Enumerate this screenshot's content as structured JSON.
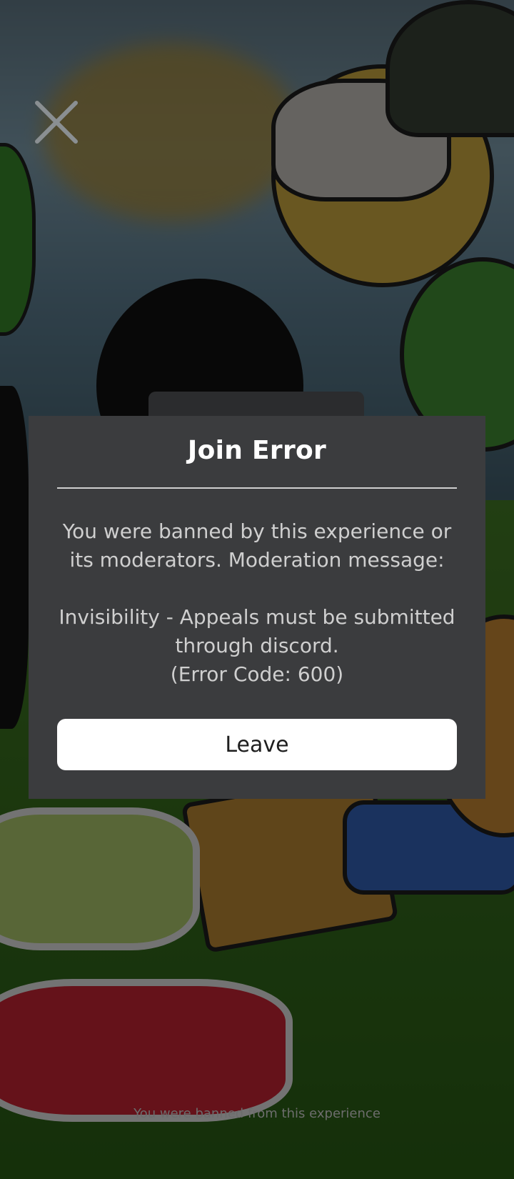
{
  "overlay": {
    "close_icon": "close-icon"
  },
  "dialog": {
    "title": "Join Error",
    "message_line1": "You were banned by this experience or",
    "message_line2": "its moderators. Moderation message:",
    "message_line3": "Invisibility - Appeals must be submitted",
    "message_line4": "through discord.",
    "error_code": "(Error Code: 600)",
    "leave_label": "Leave"
  },
  "background": {
    "status_text": "You were banned from this experience"
  },
  "colors": {
    "dialog_bg": "#3b3c3e",
    "button_bg": "#ffffff",
    "title_text": "#ffffff",
    "body_text": "#cfcfcf"
  }
}
